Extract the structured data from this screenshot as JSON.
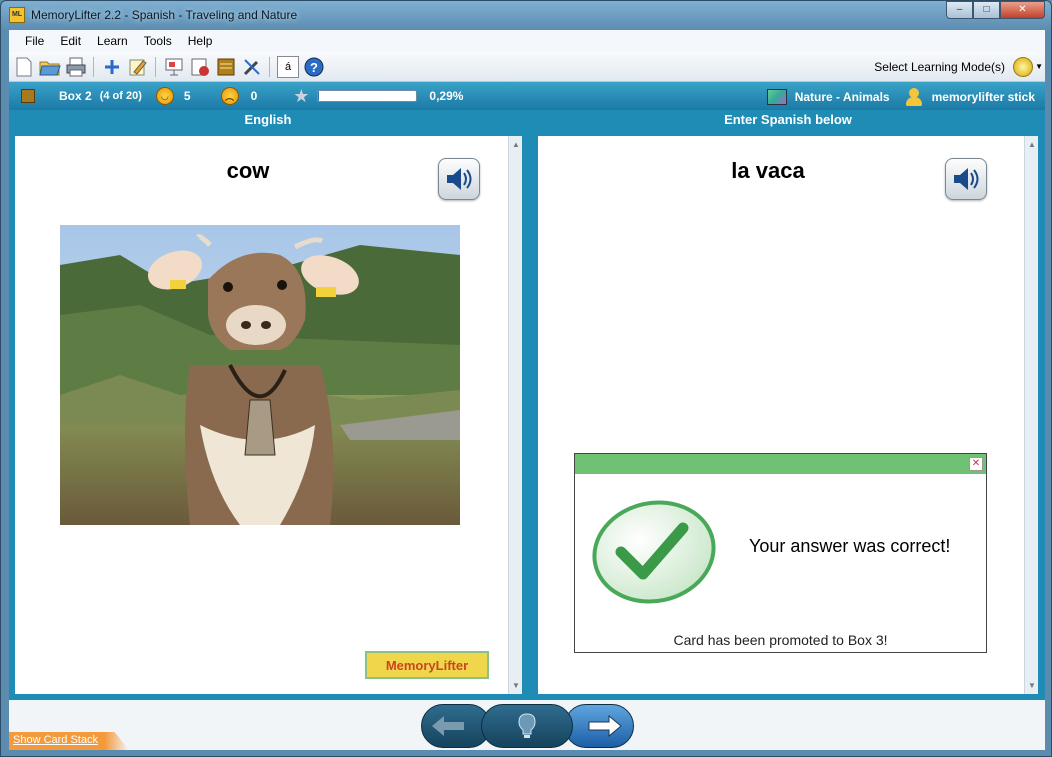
{
  "window": {
    "title": "MemoryLifter 2.2 - Spanish - Traveling and Nature",
    "app_icon_text": "ML",
    "controls": [
      "–",
      "□",
      "✕"
    ]
  },
  "menu": [
    "File",
    "Edit",
    "Learn",
    "Tools",
    "Help"
  ],
  "toolbar": {
    "buttons": [
      "new-icon",
      "open-icon",
      "print-icon",
      "add-icon",
      "edit-icon",
      "presentation-icon",
      "statistics-icon",
      "box-icon",
      "tools-icon",
      "character-icon",
      "help-icon"
    ],
    "character_glyph": "á",
    "mode_label": "Select Learning Mode(s)"
  },
  "status": {
    "box": "Box 2",
    "box_count": "(4 of 20)",
    "correct": "5",
    "wrong": "0",
    "progress_pct": 0.29,
    "progress_label": "0,29%",
    "chapter": "Nature - Animals",
    "user": "memorylifter stick"
  },
  "panels": {
    "left_heading": "English",
    "right_heading": "Enter Spanish below",
    "question_word": "cow",
    "answer_word": "la vaca",
    "logo_text": "MemoryLifter"
  },
  "dialog": {
    "close": "✕",
    "title": "Your answer was correct!",
    "message": "Card has been promoted to Box 3!"
  },
  "bottom": {
    "show_stack": "Show Card Stack"
  }
}
